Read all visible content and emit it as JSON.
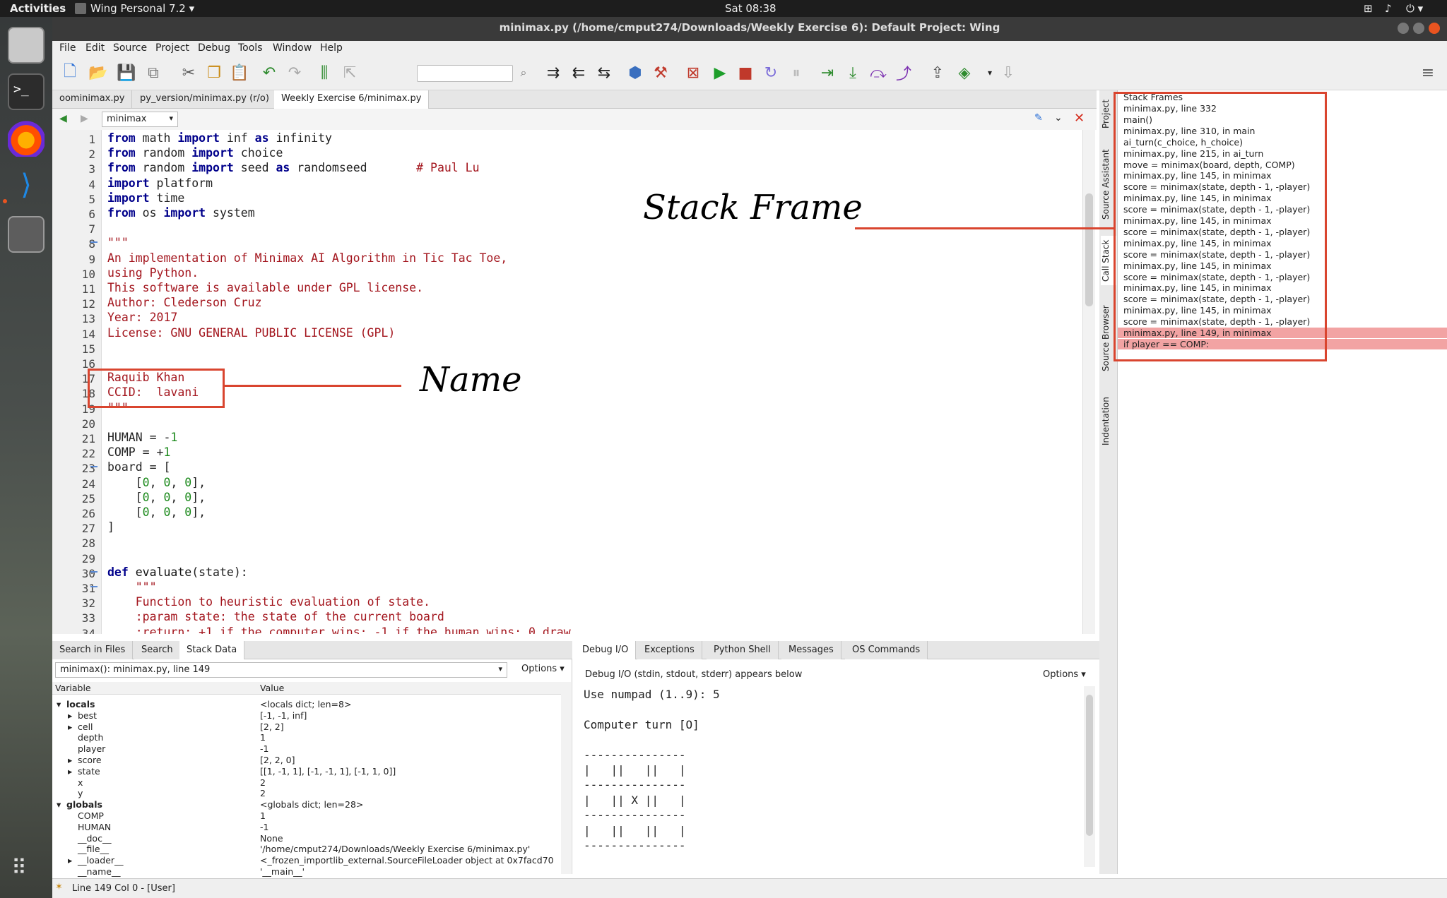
{
  "topbar": {
    "activities": "Activities",
    "app": "Wing Personal 7.2 ▾",
    "clock": "Sat 08:38"
  },
  "window_title": "minimax.py (/home/cmput274/Downloads/Weekly Exercise 6): Default Project: Wing",
  "menu": [
    "File",
    "Edit",
    "Source",
    "Project",
    "Debug",
    "Tools",
    "Window",
    "Help"
  ],
  "tabs": [
    "oominimax.py",
    "py_version/minimax.py (r/o)",
    "Weekly Exercise 6/minimax.py"
  ],
  "nav_scope": "minimax",
  "code_lines": [
    {
      "n": "1",
      "html": "<span class='kw'>from</span> math <span class='kw'>import</span> inf <span class='kw'>as</span> infinity"
    },
    {
      "n": "2",
      "html": "<span class='kw'>from</span> random <span class='kw'>import</span> choice"
    },
    {
      "n": "3",
      "html": "<span class='kw'>from</span> random <span class='kw'>import</span> seed <span class='kw'>as</span> randomseed       <span class='cm'># Paul Lu</span>"
    },
    {
      "n": "4",
      "html": "<span class='kw'>import</span> platform"
    },
    {
      "n": "5",
      "html": "<span class='kw'>import</span> time"
    },
    {
      "n": "6",
      "html": "<span class='kw'>from</span> os <span class='kw'>import</span> system"
    },
    {
      "n": "7",
      "html": ""
    },
    {
      "n": "8",
      "html": "<span class='str'>\"\"\"</span>"
    },
    {
      "n": "9",
      "html": "<span class='str'>An implementation of Minimax AI Algorithm in Tic Tac Toe,</span>"
    },
    {
      "n": "10",
      "html": "<span class='str'>using Python.</span>"
    },
    {
      "n": "11",
      "html": "<span class='str'>This software is available under GPL license.</span>"
    },
    {
      "n": "12",
      "html": "<span class='str'>Author: Clederson Cruz</span>"
    },
    {
      "n": "13",
      "html": "<span class='str'>Year: 2017</span>"
    },
    {
      "n": "14",
      "html": "<span class='str'>License: GNU GENERAL PUBLIC LICENSE (GPL)</span>"
    },
    {
      "n": "15",
      "html": ""
    },
    {
      "n": "16",
      "html": ""
    },
    {
      "n": "17",
      "html": "<span class='str'>Raquib Khan</span>"
    },
    {
      "n": "18",
      "html": "<span class='str'>CCID:  lavani</span>"
    },
    {
      "n": "19",
      "html": "<span class='str'>\"\"\"</span>"
    },
    {
      "n": "20",
      "html": ""
    },
    {
      "n": "21",
      "html": "HUMAN = -<span class='num'>1</span>"
    },
    {
      "n": "22",
      "html": "COMP = +<span class='num'>1</span>"
    },
    {
      "n": "23",
      "html": "board = ["
    },
    {
      "n": "24",
      "html": "    [<span class='num'>0</span>, <span class='num'>0</span>, <span class='num'>0</span>],"
    },
    {
      "n": "25",
      "html": "    [<span class='num'>0</span>, <span class='num'>0</span>, <span class='num'>0</span>],"
    },
    {
      "n": "26",
      "html": "    [<span class='num'>0</span>, <span class='num'>0</span>, <span class='num'>0</span>],"
    },
    {
      "n": "27",
      "html": "]"
    },
    {
      "n": "28",
      "html": ""
    },
    {
      "n": "29",
      "html": ""
    },
    {
      "n": "30",
      "html": "<span class='kw'>def</span> <span class='fn'>evaluate</span>(state):"
    },
    {
      "n": "31",
      "html": "    <span class='str'>\"\"\"</span>"
    },
    {
      "n": "32",
      "html": "    <span class='str'>Function to heuristic evaluation of state.</span>"
    },
    {
      "n": "33",
      "html": "    <span class='str'>:param state: the state of the current board</span>"
    },
    {
      "n": "34",
      "html": "    <span class='str'>:return: +1 if the computer wins; -1 if the human wins; 0 draw</span>"
    }
  ],
  "side_tabs": [
    "Project",
    "Source Assistant",
    "Call Stack",
    "Source Browser",
    "Indentation"
  ],
  "stack": {
    "title": "Stack Frames",
    "lines": [
      "minimax.py,  line 332",
      "  main()",
      "minimax.py,  line 310, in main",
      "  ai_turn(c_choice, h_choice)",
      "minimax.py,  line 215, in ai_turn",
      "  move = minimax(board, depth, COMP)",
      "minimax.py,  line 145, in minimax",
      "  score = minimax(state, depth - 1, -player)",
      "minimax.py,  line 145, in minimax",
      "  score = minimax(state, depth - 1, -player)",
      "minimax.py,  line 145, in minimax",
      "  score = minimax(state, depth - 1, -player)",
      "minimax.py,  line 145, in minimax",
      "  score = minimax(state, depth - 1, -player)",
      "minimax.py,  line 145, in minimax",
      "  score = minimax(state, depth - 1, -player)",
      "minimax.py,  line 145, in minimax",
      "  score = minimax(state, depth - 1, -player)",
      "minimax.py,  line 145, in minimax",
      "  score = minimax(state, depth - 1, -player)",
      "minimax.py,  line 149, in minimax",
      "  if player == COMP:"
    ],
    "highlight_color": "#f2a3a3"
  },
  "bottom_left": {
    "tabs": [
      "Search in Files",
      "Search",
      "Stack Data"
    ],
    "frame": "minimax(): minimax.py, line 149",
    "options": "Options ▾",
    "col_variable": "Variable",
    "col_value": "Value",
    "rows": [
      {
        "arrow": "▾",
        "name": "locals",
        "value": "<locals dict; len=8>",
        "bold": true
      },
      {
        "arrow": "▸",
        "name": "best",
        "value": "[-1, -1, inf]"
      },
      {
        "arrow": "▸",
        "name": "cell",
        "value": "[2, 2]"
      },
      {
        "arrow": "",
        "name": "depth",
        "value": "1"
      },
      {
        "arrow": "",
        "name": "player",
        "value": "-1"
      },
      {
        "arrow": "▸",
        "name": "score",
        "value": "[2, 2, 0]"
      },
      {
        "arrow": "▸",
        "name": "state",
        "value": "[[1, -1, 1], [-1, -1, 1], [-1, 1, 0]]"
      },
      {
        "arrow": "",
        "name": "x",
        "value": "2"
      },
      {
        "arrow": "",
        "name": "y",
        "value": "2"
      },
      {
        "arrow": "▾",
        "name": "globals",
        "value": "<globals dict; len=28>",
        "bold": true
      },
      {
        "arrow": "",
        "name": "COMP",
        "value": "1"
      },
      {
        "arrow": "",
        "name": "HUMAN",
        "value": "-1"
      },
      {
        "arrow": "",
        "name": "__doc__",
        "value": "None"
      },
      {
        "arrow": "",
        "name": "__file__",
        "value": "'/home/cmput274/Downloads/Weekly Exercise 6/minimax.py'"
      },
      {
        "arrow": "▸",
        "name": "__loader__",
        "value": "<_frozen_importlib_external.SourceFileLoader object at 0x7facd70"
      },
      {
        "arrow": "",
        "name": "__name__",
        "value": "'__main__'"
      }
    ]
  },
  "bottom_right": {
    "tabs": [
      "Debug I/O",
      "Exceptions",
      "Python Shell",
      "Messages",
      "OS Commands"
    ],
    "header": "Debug I/O (stdin, stdout, stderr) appears below",
    "options": "Options ▾",
    "output": [
      "Use numpad (1..9): 5",
      "",
      "Computer turn [O]",
      "",
      "---------------",
      "|   ||   ||   |",
      "---------------",
      "|   || X ||   |",
      "---------------",
      "|   ||   ||   |",
      "---------------"
    ]
  },
  "status": "Line 149 Col 0 - [User]",
  "annotations": {
    "stack_label": "Stack Frame",
    "name_label": "Name",
    "color": "#d9452f"
  }
}
